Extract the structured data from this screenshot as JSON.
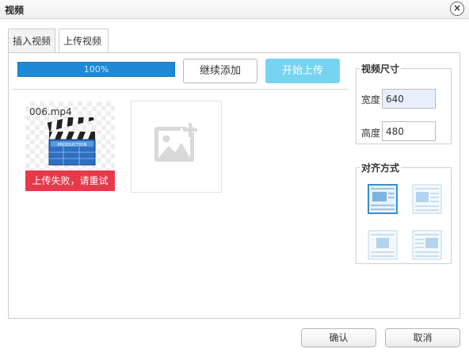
{
  "dialog": {
    "title": "视频",
    "close_glyph": "×"
  },
  "tabs": [
    {
      "label": "插入视频",
      "active": false
    },
    {
      "label": "上传视频",
      "active": true
    }
  ],
  "upload": {
    "progress_percent": 100,
    "progress_text": "100%",
    "add_more_label": "继续添加",
    "start_upload_label": "开始上传",
    "accent_color": "#1e8ad6",
    "start_button_color": "#76d3f2"
  },
  "files": [
    {
      "name": "006.mp4",
      "icon": "video-clapperboard-icon",
      "clapper_text": "PRODUCTION",
      "status": "上传失败，请重试",
      "status_color": "#e8394a"
    }
  ],
  "add_placeholder": {
    "icon": "add-image-icon"
  },
  "video_size": {
    "legend": "视频尺寸",
    "width_label": "宽度",
    "width_value": "640",
    "height_label": "高度",
    "height_value": "480"
  },
  "alignment": {
    "legend": "对齐方式",
    "options": [
      {
        "icon": "align-none-icon",
        "selected": true
      },
      {
        "icon": "align-left-icon",
        "selected": false
      },
      {
        "icon": "align-center-icon",
        "selected": false
      },
      {
        "icon": "align-right-icon",
        "selected": false
      }
    ]
  },
  "footer": {
    "ok_label": "确认",
    "cancel_label": "取消"
  }
}
